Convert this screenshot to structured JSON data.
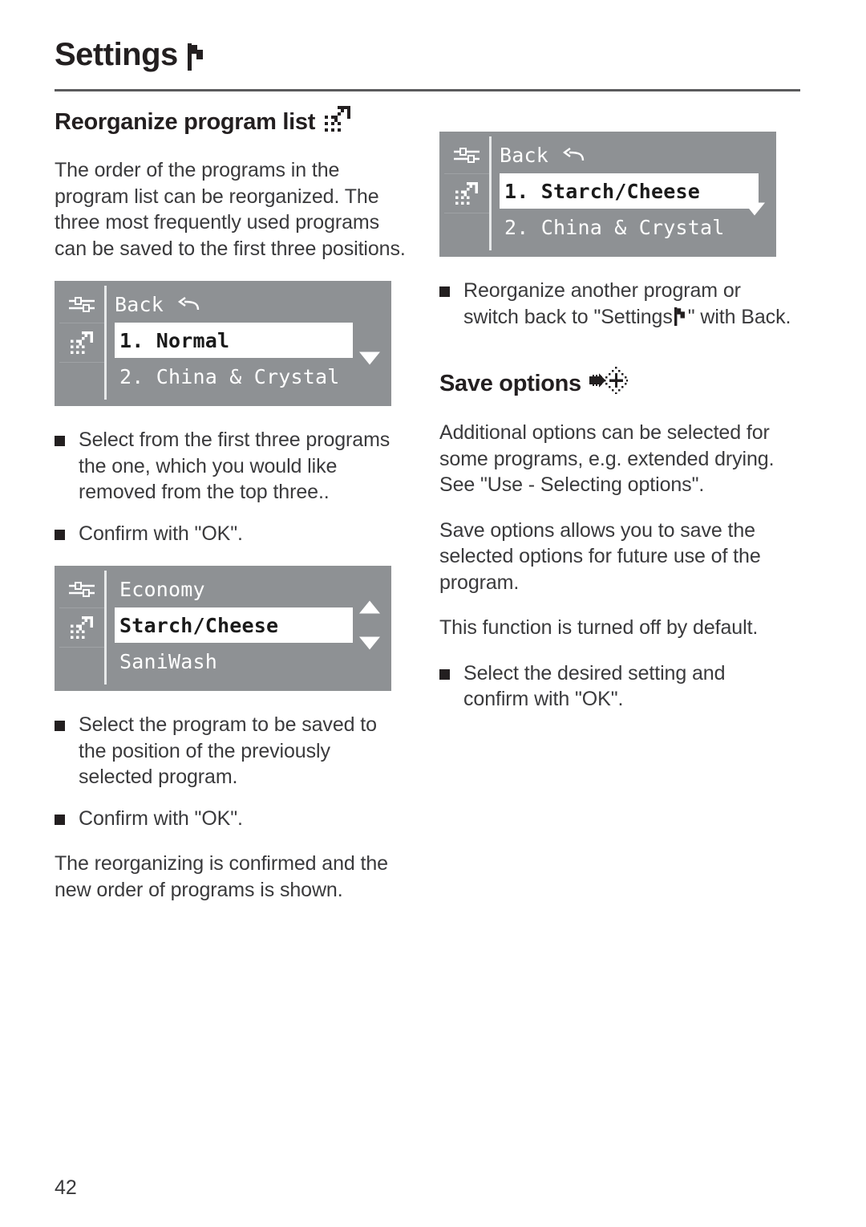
{
  "header": {
    "title": "Settings",
    "icon": "flag-icon"
  },
  "page_number": "42",
  "left_column": {
    "heading": {
      "text": "Reorganize program list",
      "icon": "reorganize-arrow-icon"
    },
    "intro": "The order of the programs in the program list can be reorganized. The three most frequently used programs can be saved to the first three positions.",
    "display_1": {
      "sidebar_icons": [
        "settings-sliders-icon",
        "reorganize-arrow-icon"
      ],
      "rows": [
        {
          "label": "Back",
          "icon": "back-arrow-icon",
          "selected": false,
          "scroll": ""
        },
        {
          "label": "1. Normal",
          "icon": "",
          "selected": true,
          "scroll": ""
        },
        {
          "label": "2. China & Crystal",
          "icon": "",
          "selected": false,
          "scroll": "down-triangle-icon"
        }
      ]
    },
    "bullets_1": [
      "Select from the first three programs the one, which you would like removed from the top three..",
      "Confirm with \"OK\"."
    ],
    "display_2": {
      "sidebar_icons": [
        "settings-sliders-icon",
        "reorganize-arrow-icon"
      ],
      "rows": [
        {
          "label": "Economy",
          "icon": "",
          "selected": false,
          "scroll": "up-triangle-icon"
        },
        {
          "label": "Starch/Cheese",
          "icon": "",
          "selected": true,
          "scroll": ""
        },
        {
          "label": "SaniWash",
          "icon": "",
          "selected": false,
          "scroll": "down-triangle-icon"
        }
      ]
    },
    "bullets_2": [
      "Select the program to be saved to the position of the previously selected program.",
      "Confirm with \"OK\"."
    ],
    "closing": "The reorganizing is confirmed and the new order of programs is shown."
  },
  "right_column": {
    "display_3": {
      "sidebar_icons": [
        "settings-sliders-icon",
        "reorganize-arrow-icon"
      ],
      "rows": [
        {
          "label": "Back",
          "icon": "back-arrow-icon",
          "selected": false,
          "scroll": ""
        },
        {
          "label": "1. Starch/Cheese",
          "icon": "",
          "selected": true,
          "scroll": ""
        },
        {
          "label": "2. China & Crystal",
          "icon": "",
          "selected": false,
          "scroll": "down-triangle-icon"
        }
      ]
    },
    "bullets_1_part_a": "Reorganize another program or switch back to \"Settings",
    "bullets_1_part_b": "\" with Back.",
    "heading": {
      "text": "Save options",
      "icon": "save-options-icon"
    },
    "paragraph_1": "Additional options can be selected for some programs, e.g. extended drying. See \"Use - Selecting options\".",
    "paragraph_2": "Save options allows you to save the selected options for future use of the program.",
    "paragraph_3": "This function is turned off by default.",
    "bullets_2": [
      "Select the desired setting and confirm with \"OK\"."
    ]
  },
  "colors": {
    "lcd_background": "#8e9194",
    "lcd_selected_background": "#ffffff",
    "text": "#3a3a3c",
    "heading": "#231f20",
    "rule": "#5b5b5d"
  }
}
